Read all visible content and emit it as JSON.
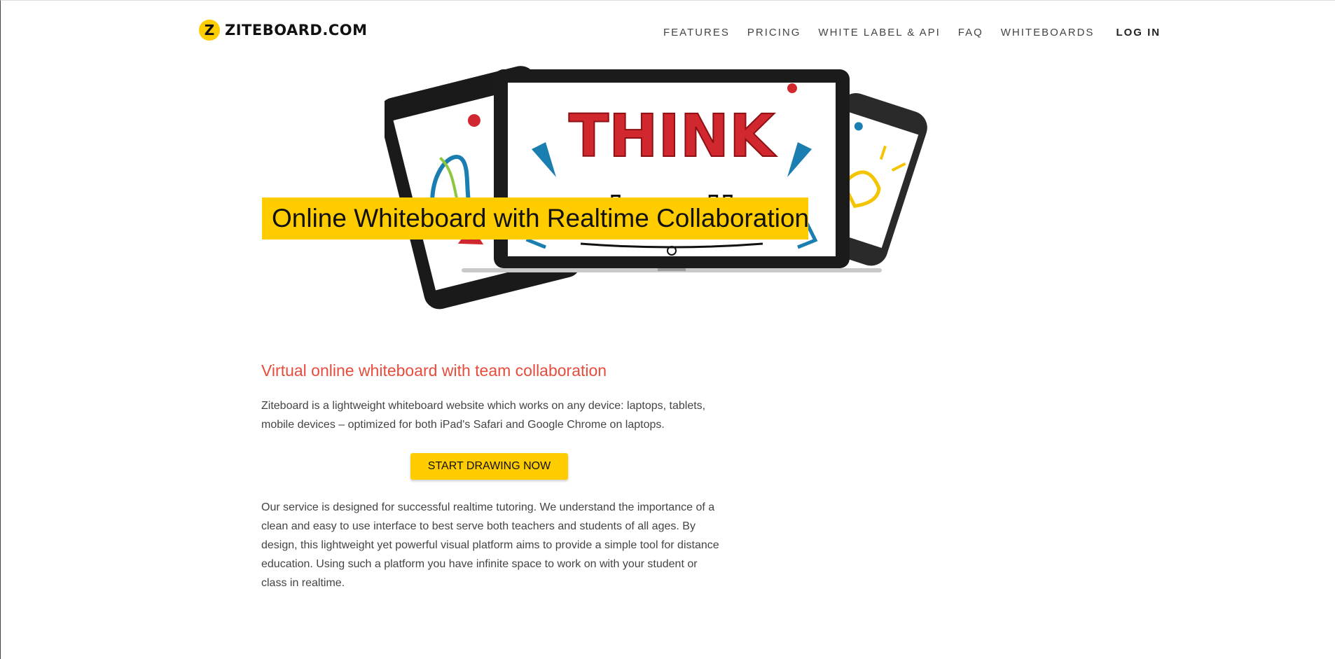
{
  "brand": {
    "name": "ZITEBOARD.COM",
    "logo_letter": "Z",
    "accent": "#ffcc00"
  },
  "nav": {
    "items": [
      "FEATURES",
      "PRICING",
      "WHITE LABEL & API",
      "FAQ",
      "WHITEBOARDS"
    ],
    "login": "LOG IN"
  },
  "hero": {
    "headline": "Online Whiteboard with Realtime Collaboration",
    "art_text_top": "THINK",
    "art_text_bottom": "visually"
  },
  "content": {
    "subtitle": "Virtual online whiteboard with team collaboration",
    "intro": "Ziteboard is a lightweight whiteboard website which works on any device: laptops, tablets, mobile devices – optimized for both iPad's Safari and Google Chrome on laptops.",
    "cta_label": "START DRAWING NOW",
    "body": "Our service is designed for successful realtime tutoring. We understand the importance of a clean and easy to use interface to best serve both teachers and students of all ages. By design, this lightweight yet powerful visual platform aims to provide a simple tool for distance education. Using such a platform you have infinite space to work on with your student or class in realtime."
  },
  "colors": {
    "subtitle": "#e74c3c",
    "think_red": "#d0282e",
    "art_blue": "#1a7fb0"
  }
}
